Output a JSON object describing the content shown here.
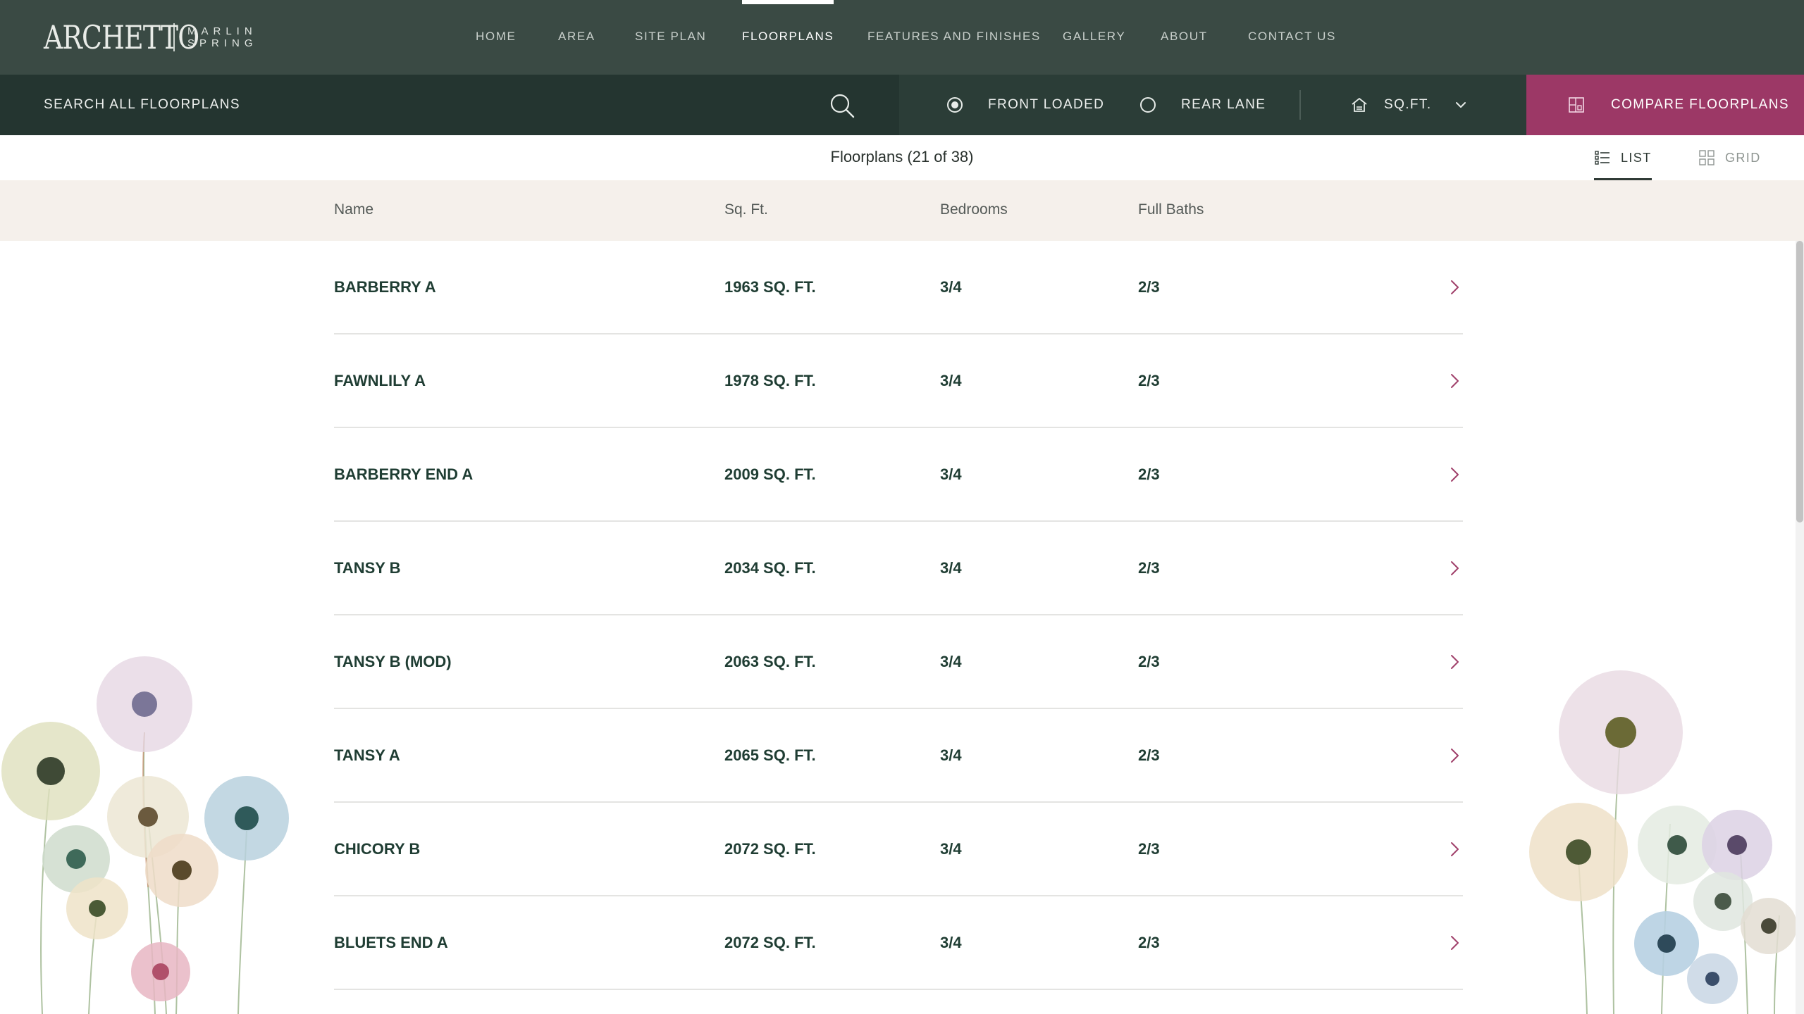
{
  "brand": {
    "logo_text": "ARCHETTO",
    "sub_line1": "MARLIN",
    "sub_line2": "SPRING"
  },
  "nav": {
    "items": [
      {
        "label": "HOME"
      },
      {
        "label": "AREA"
      },
      {
        "label": "SITE PLAN"
      },
      {
        "label": "FLOORPLANS"
      },
      {
        "label": "FEATURES AND FINISHES"
      },
      {
        "label": "GALLERY"
      },
      {
        "label": "ABOUT"
      },
      {
        "label": "CONTACT US"
      }
    ],
    "active": "FLOORPLANS"
  },
  "filters": {
    "search_placeholder": "SEARCH ALL FLOORPLANS",
    "options": [
      {
        "label": "FRONT LOADED",
        "checked": true
      },
      {
        "label": "REAR LANE",
        "checked": false
      }
    ],
    "sort_label": "SQ.FT.",
    "compare_label": "COMPARE FLOORPLANS"
  },
  "results": {
    "count_text": "Floorplans (21 of 38)",
    "views": {
      "list": "LIST",
      "grid": "GRID",
      "active": "list"
    }
  },
  "table": {
    "headers": {
      "name": "Name",
      "sqft": "Sq. Ft.",
      "bedrooms": "Bedrooms",
      "baths": "Full Baths"
    },
    "rows": [
      {
        "name": "BARBERRY A",
        "sqft": "1963 SQ. FT.",
        "bedrooms": "3/4",
        "baths": "2/3"
      },
      {
        "name": "FAWNLILY A",
        "sqft": "1978 SQ. FT.",
        "bedrooms": "3/4",
        "baths": "2/3"
      },
      {
        "name": "BARBERRY END A",
        "sqft": "2009 SQ. FT.",
        "bedrooms": "3/4",
        "baths": "2/3"
      },
      {
        "name": "TANSY B",
        "sqft": "2034 SQ. FT.",
        "bedrooms": "3/4",
        "baths": "2/3"
      },
      {
        "name": "TANSY B (MOD)",
        "sqft": "2063 SQ. FT.",
        "bedrooms": "3/4",
        "baths": "2/3"
      },
      {
        "name": "TANSY A",
        "sqft": "2065 SQ. FT.",
        "bedrooms": "3/4",
        "baths": "2/3"
      },
      {
        "name": "CHICORY B",
        "sqft": "2072 SQ. FT.",
        "bedrooms": "3/4",
        "baths": "2/3"
      },
      {
        "name": "BLUETS END A",
        "sqft": "2072 SQ. FT.",
        "bedrooms": "3/4",
        "baths": "2/3"
      }
    ]
  },
  "colors": {
    "nav_bg": "#3a4a44",
    "search_bg": "#243530",
    "filter_bg": "#2b3d37",
    "compare_bg": "#9c3866",
    "table_header_bg": "#f5f0eb",
    "row_text": "#1f3d33",
    "chevron": "#a0406a"
  },
  "icons": {
    "search": "search-icon",
    "house": "house-icon",
    "compare": "compare-icon",
    "list": "list-icon",
    "grid": "grid-icon",
    "row_arrow": "chevron-right-icon",
    "dropdown": "chevron-down-icon"
  }
}
